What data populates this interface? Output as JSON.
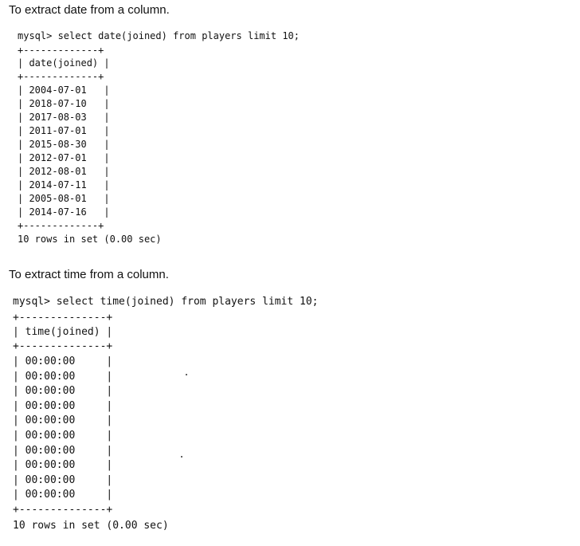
{
  "section1": {
    "caption": "To extract date from a column.",
    "query": "mysql> select date(joined) from players limit 10;",
    "border": "+-------------+",
    "header": "| date(joined) |",
    "rows": [
      "| 2004-07-01   |",
      "| 2018-07-10   |",
      "| 2017-08-03   |",
      "| 2011-07-01   |",
      "| 2015-08-30   |",
      "| 2012-07-01   |",
      "| 2012-08-01   |",
      "| 2014-07-11   |",
      "| 2005-08-01   |",
      "| 2014-07-16   |"
    ],
    "footer": "10 rows in set (0.00 sec)"
  },
  "section2": {
    "caption": "To extract time from a column.",
    "query": "mysql> select time(joined) from players limit 10;",
    "border": "+--------------+",
    "header": "| time(joined) |",
    "rows": [
      "| 00:00:00     |",
      "| 00:00:00     |",
      "| 00:00:00     |",
      "| 00:00:00     |",
      "| 00:00:00     |",
      "| 00:00:00     |",
      "| 00:00:00     |",
      "| 00:00:00     |",
      "| 00:00:00     |",
      "| 00:00:00     |"
    ],
    "footer": "10 rows in set (0.00 sec)"
  }
}
